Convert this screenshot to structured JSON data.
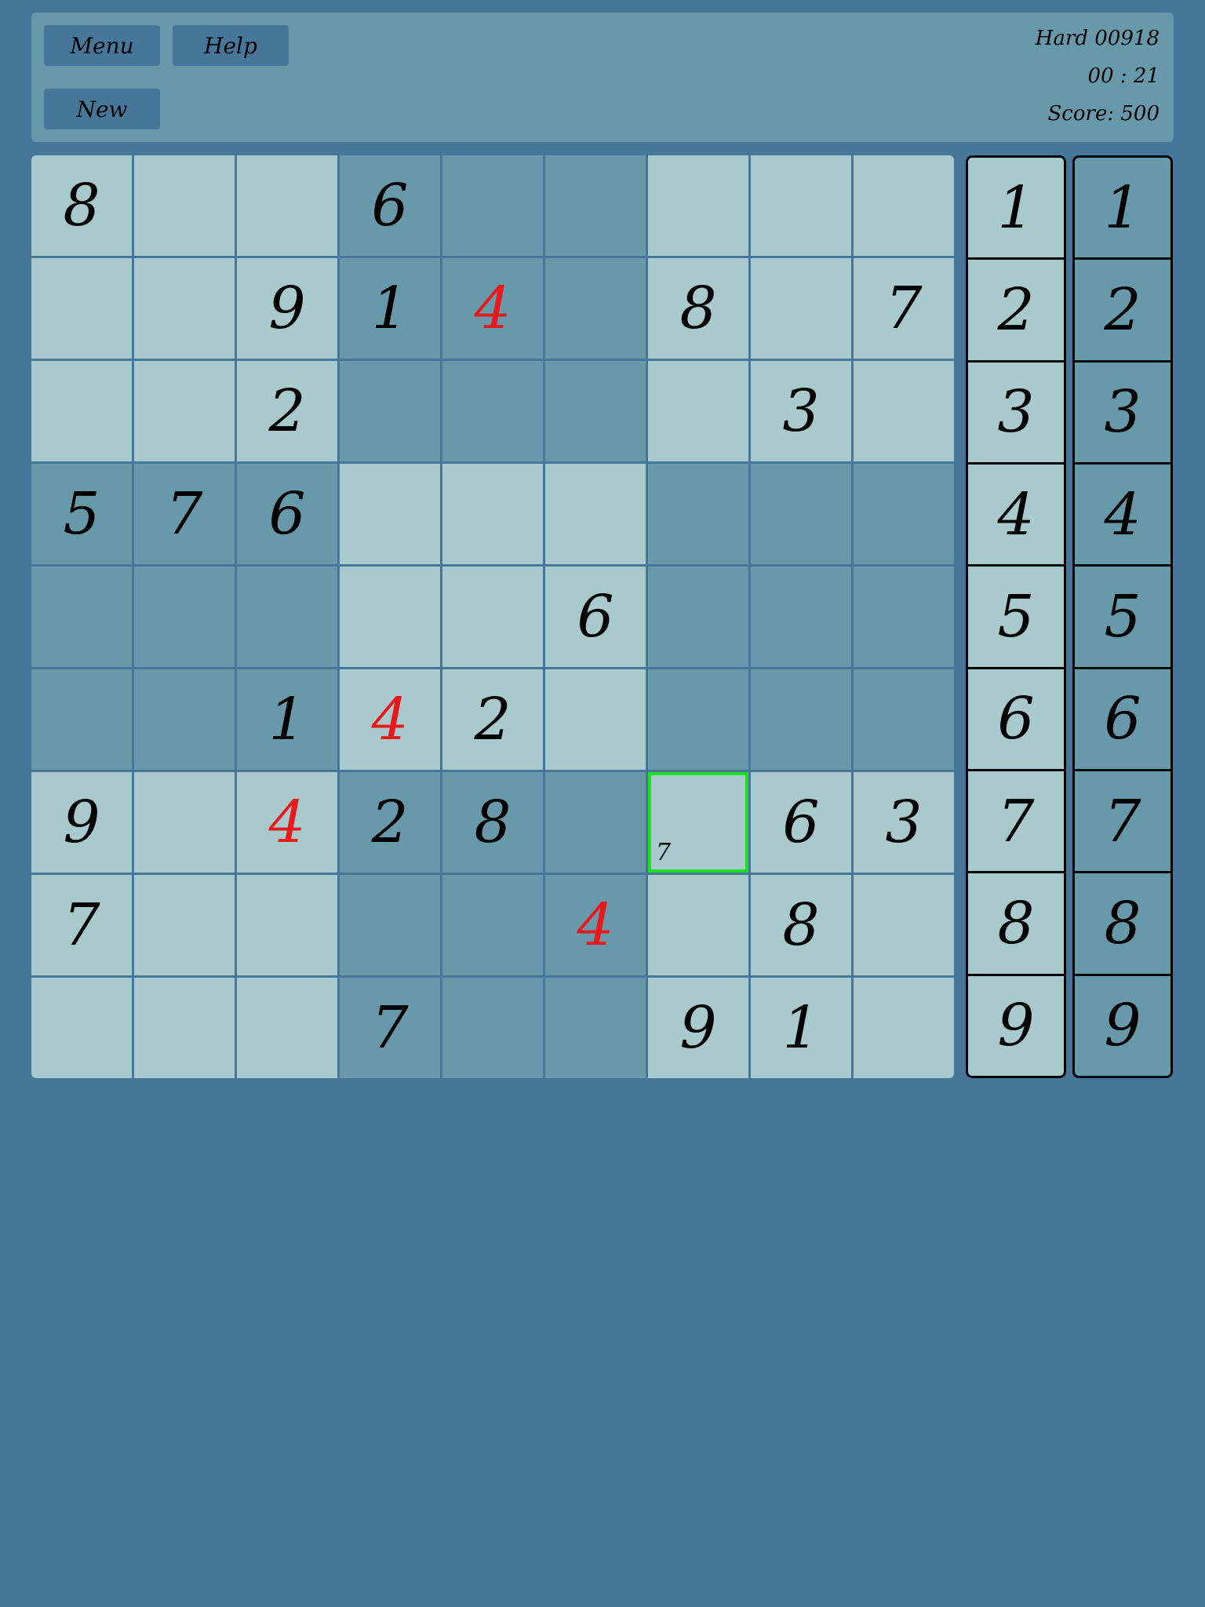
{
  "header": {
    "menu_label": "Menu",
    "help_label": "Help",
    "new_label": "New",
    "puzzle_title": "Hard 00918",
    "timer": "00 : 21",
    "score": "Score: 500"
  },
  "colors": {
    "background": "#46779a",
    "cell_light": "#a8cacd",
    "cell_dark": "#6799aa",
    "error_digit": "#e8191b",
    "selection": "#1de01d"
  },
  "board": {
    "rows": [
      [
        "8",
        "",
        "",
        "6",
        "",
        "",
        "",
        "",
        ""
      ],
      [
        "",
        "",
        "9",
        "1",
        "4",
        "",
        "8",
        "",
        "7"
      ],
      [
        "",
        "",
        "2",
        "",
        "",
        "",
        "",
        "3",
        ""
      ],
      [
        "5",
        "7",
        "6",
        "",
        "",
        "",
        "",
        "",
        ""
      ],
      [
        "",
        "",
        "",
        "",
        "",
        "6",
        "",
        "",
        ""
      ],
      [
        "",
        "",
        "1",
        "4",
        "2",
        "",
        "",
        "",
        ""
      ],
      [
        "9",
        "",
        "4",
        "2",
        "8",
        "",
        "",
        "6",
        "3"
      ],
      [
        "7",
        "",
        "",
        "",
        "",
        "4",
        "",
        "8",
        ""
      ],
      [
        "",
        "",
        "",
        "7",
        "",
        "",
        "9",
        "1",
        ""
      ]
    ],
    "errors": [
      [
        1,
        4
      ],
      [
        5,
        3
      ],
      [
        6,
        2
      ],
      [
        7,
        5
      ]
    ],
    "selected": [
      6,
      6
    ],
    "notes": {
      "6-6": "7"
    }
  },
  "palette": {
    "left": [
      "1",
      "2",
      "3",
      "4",
      "5",
      "6",
      "7",
      "8",
      "9"
    ],
    "right": [
      "1",
      "2",
      "3",
      "4",
      "5",
      "6",
      "7",
      "8",
      "9"
    ]
  }
}
